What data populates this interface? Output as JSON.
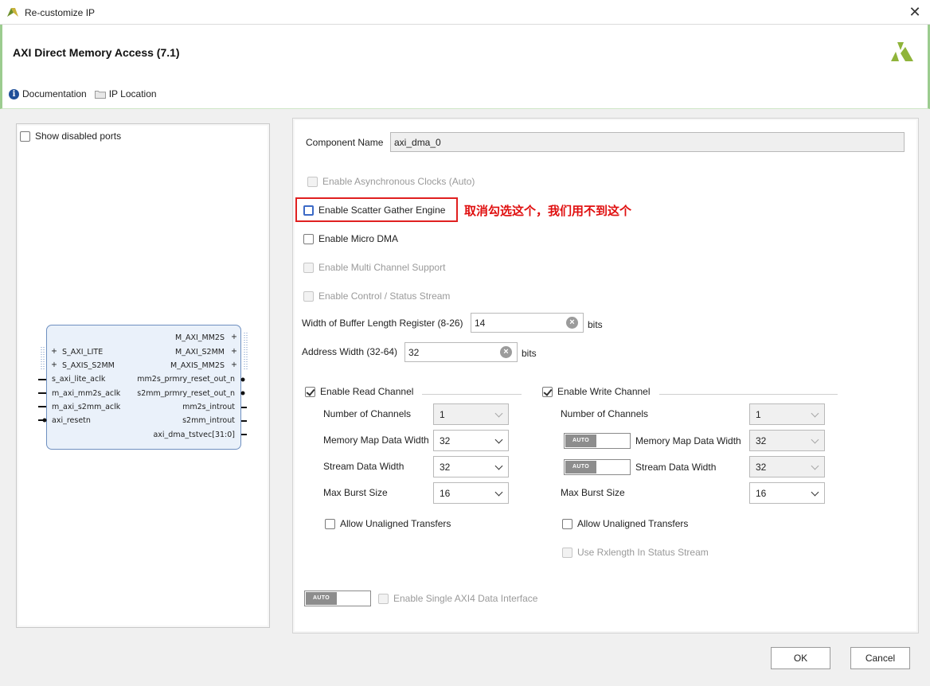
{
  "window": {
    "title": "Re-customize IP",
    "close_glyph": "✕"
  },
  "header": {
    "ip_name": "AXI Direct Memory Access (7.1)",
    "documentation": "Documentation",
    "ip_location": "IP Location"
  },
  "left": {
    "show_disabled_ports": "Show disabled ports",
    "block": {
      "left_ports": [
        "S_AXI_LITE",
        "S_AXIS_S2MM",
        "s_axi_lite_aclk",
        "m_axi_mm2s_aclk",
        "m_axi_s2mm_aclk",
        "axi_resetn"
      ],
      "right_ports": [
        "M_AXI_MM2S",
        "M_AXI_S2MM",
        "M_AXIS_MM2S",
        "mm2s_prmry_reset_out_n",
        "s2mm_prmry_reset_out_n",
        "mm2s_introut",
        "s2mm_introut",
        "axi_dma_tstvec[31:0]"
      ]
    }
  },
  "form": {
    "component_name_label": "Component Name",
    "component_name_value": "axi_dma_0",
    "async_clocks": "Enable Asynchronous Clocks (Auto)",
    "scatter_gather": "Enable Scatter Gather Engine",
    "annotation": "取消勾选这个，我们用不到这个",
    "micro_dma": "Enable Micro DMA",
    "multi_channel": "Enable Multi Channel Support",
    "control_status": "Enable Control / Status Stream",
    "buffer_len_label": "Width of Buffer Length Register (8-26)",
    "buffer_len_value": "14",
    "address_width_label": "Address Width (32-64)",
    "address_width_value": "32",
    "bits": "bits",
    "read": {
      "title": "Enable Read Channel",
      "num_channels_label": "Number of Channels",
      "num_channels": "1",
      "mm_width_label": "Memory Map Data Width",
      "mm_width": "32",
      "stream_width_label": "Stream Data Width",
      "stream_width": "32",
      "burst_label": "Max Burst Size",
      "burst": "16",
      "unaligned": "Allow Unaligned Transfers"
    },
    "write": {
      "title": "Enable Write Channel",
      "num_channels_label": "Number of Channels",
      "num_channels": "1",
      "mm_width_label": "Memory Map Data Width",
      "mm_width": "32",
      "stream_width_label": "Stream Data Width",
      "stream_width": "32",
      "burst_label": "Max Burst Size",
      "burst": "16",
      "unaligned": "Allow Unaligned Transfers",
      "rxlength": "Use Rxlength In Status Stream"
    },
    "auto_label": "AUTO",
    "single_axi4": "Enable Single AXI4 Data Interface"
  },
  "buttons": {
    "ok": "OK",
    "cancel": "Cancel"
  }
}
